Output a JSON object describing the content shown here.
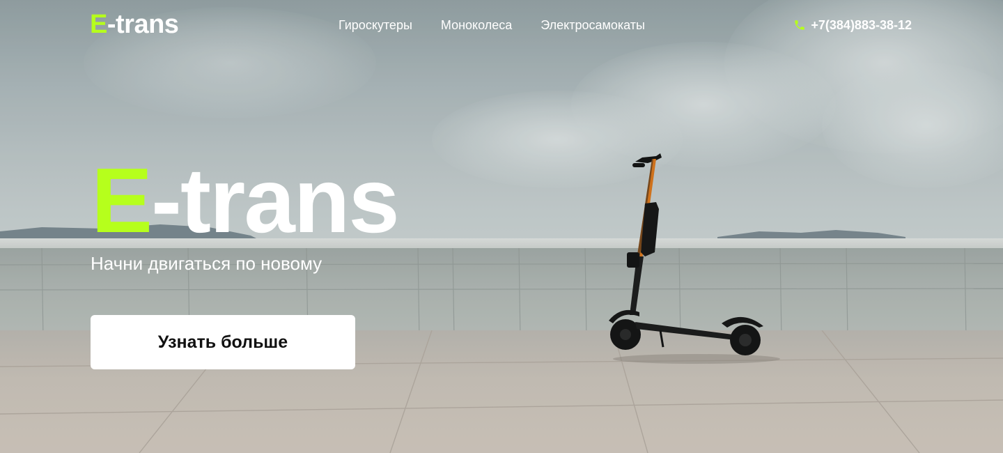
{
  "header": {
    "logo": {
      "accent": "E",
      "rest": "-trans"
    },
    "nav": [
      {
        "label": "Гироскутеры"
      },
      {
        "label": "Моноколеса"
      },
      {
        "label": "Электросамокаты"
      }
    ],
    "phone": {
      "icon": "phone-icon",
      "number": "+7(384)883-38-12"
    }
  },
  "hero": {
    "title": {
      "accent": "E",
      "rest": "-trans"
    },
    "subtitle": "Начни двигаться по новому",
    "cta_label": "Узнать больше"
  },
  "colors": {
    "accent": "#b6ff1c",
    "text": "#ffffff",
    "button_bg": "#ffffff",
    "button_text": "#111111"
  }
}
